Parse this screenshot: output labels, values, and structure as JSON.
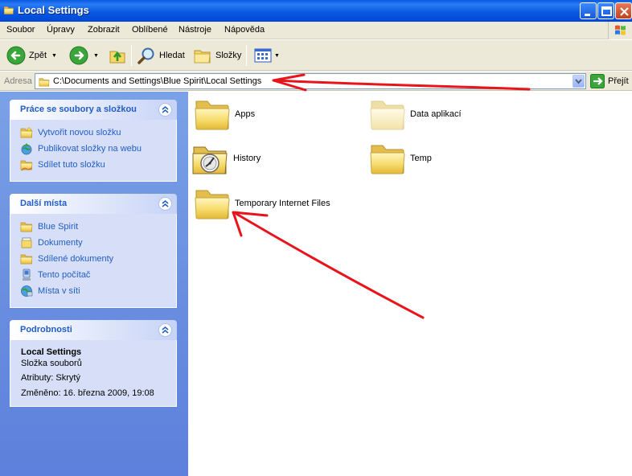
{
  "window": {
    "title": "Local Settings"
  },
  "menu": [
    "Soubor",
    "Úpravy",
    "Zobrazit",
    "Oblíbené",
    "Nástroje",
    "Nápověda"
  ],
  "toolbar": {
    "back": "Zpět",
    "search": "Hledat",
    "folders": "Složky"
  },
  "address": {
    "label": "Adresa",
    "path": "C:\\Documents and Settings\\Blue Spirit\\Local Settings",
    "go": "Přejít"
  },
  "tasks": {
    "title": "Práce se soubory a složkou",
    "items": [
      "Vytvořit novou složku",
      "Publikovat složky na webu",
      "Sdílet tuto složku"
    ]
  },
  "places": {
    "title": "Další místa",
    "items": [
      "Blue Spirit",
      "Dokumenty",
      "Sdílené dokumenty",
      "Tento počítač",
      "Místa v síti"
    ]
  },
  "details": {
    "title": "Podrobnosti",
    "name": "Local Settings",
    "type": "Složka souborů",
    "attributes": "Atributy: Skrytý",
    "modified": "Změněno: 16. března 2009, 19:08"
  },
  "folders": [
    {
      "name": "Apps",
      "icon": "folder-icon"
    },
    {
      "name": "Data aplikací",
      "icon": "folder-icon-hidden"
    },
    {
      "name": "History",
      "icon": "history-folder-icon"
    },
    {
      "name": "Temp",
      "icon": "folder-icon"
    },
    {
      "name": "Temporary Internet Files",
      "icon": "folder-icon"
    }
  ],
  "colors": {
    "titlebar": "#0a59e0",
    "taskpane": "#6a8fe0",
    "link": "#215dc6",
    "annotation": "#e8141c"
  }
}
